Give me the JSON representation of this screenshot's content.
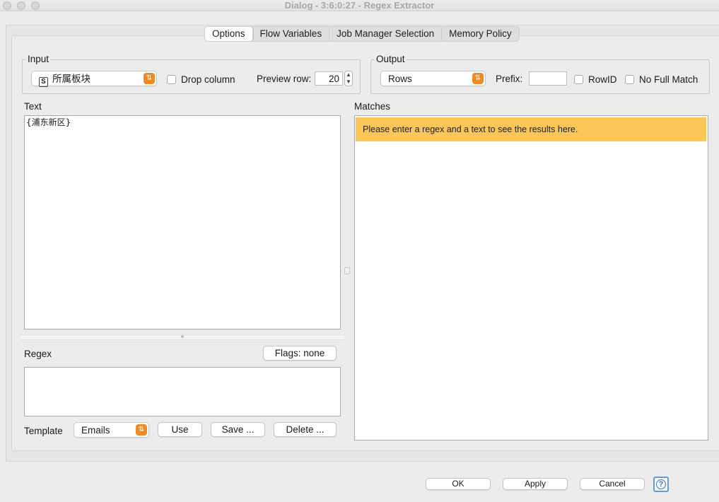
{
  "window": {
    "title": "Dialog - 3:6:0:27 - Regex Extractor"
  },
  "tabs": [
    "Options",
    "Flow Variables",
    "Job Manager Selection",
    "Memory Policy"
  ],
  "input": {
    "legend": "Input",
    "column_type_icon": "S",
    "column_value": "所属板块",
    "drop_column_label": "Drop column",
    "preview_row_label": "Preview row:",
    "preview_row_value": "20"
  },
  "output": {
    "legend": "Output",
    "mode_value": "Rows",
    "prefix_label": "Prefix:",
    "prefix_value": "",
    "rowid_label": "RowID",
    "no_full_match_label": "No Full Match"
  },
  "text_panel": {
    "label": "Text",
    "content": "{浦东新区}"
  },
  "regex_panel": {
    "label": "Regex",
    "flags_button": "Flags: none",
    "content": ""
  },
  "template": {
    "label": "Template",
    "value": "Emails",
    "use_button": "Use",
    "save_button": "Save ...",
    "delete_button": "Delete ..."
  },
  "matches": {
    "label": "Matches",
    "notice": "Please enter a regex and a text to see the results here.",
    "notice_color": "#fcc557"
  },
  "footer": {
    "ok": "OK",
    "apply": "Apply",
    "cancel": "Cancel",
    "help_icon": "?"
  },
  "icons": {
    "combo_arrow": "up-down-chevron-icon",
    "help": "help-icon"
  }
}
